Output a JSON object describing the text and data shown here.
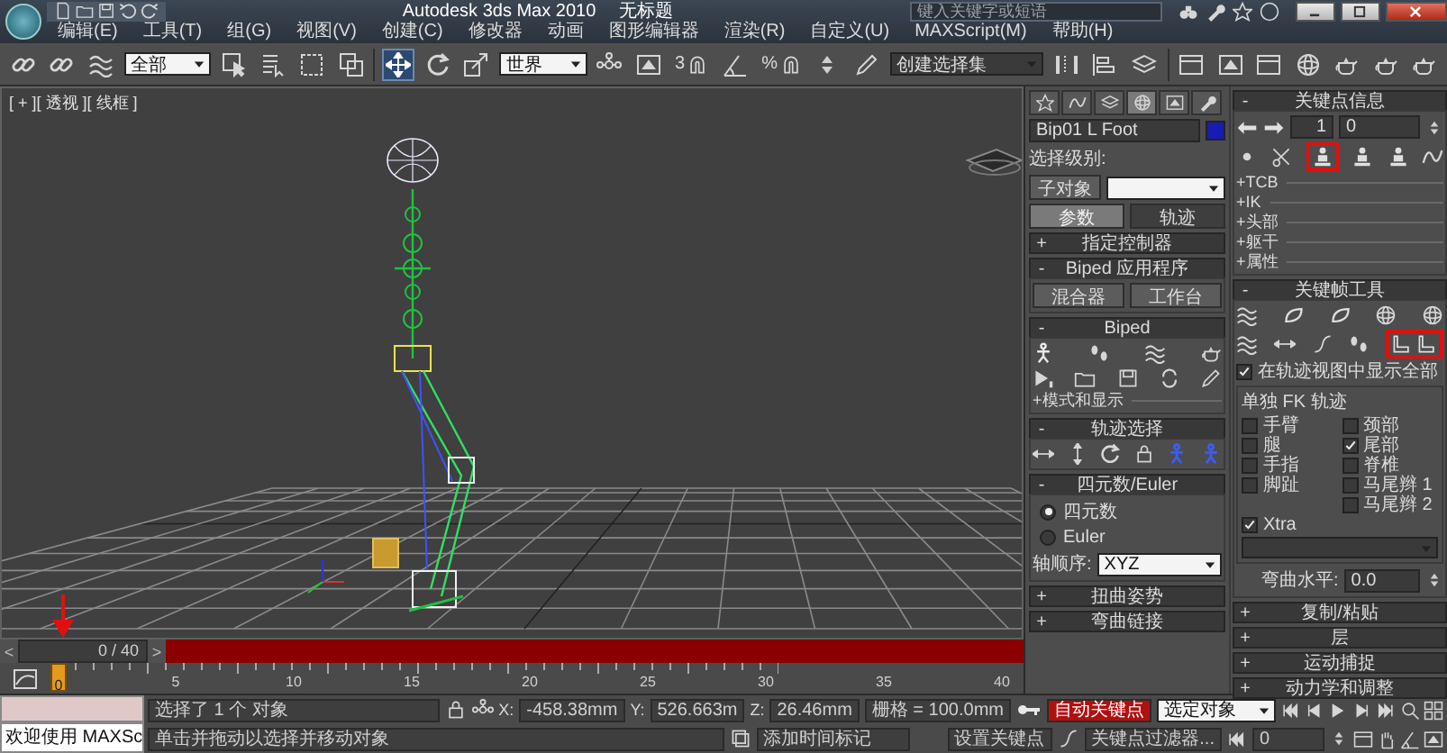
{
  "title_bar": {
    "title": "Autodesk 3ds Max 2010",
    "document": "无标题",
    "search": {
      "placeholder": "键入关键字或短语"
    }
  },
  "menu": [
    "编辑(E)",
    "工具(T)",
    "组(G)",
    "视图(V)",
    "创建(C)",
    "修改器",
    "动画",
    "图形编辑器",
    "渲染(R)",
    "自定义(U)",
    "MAXScript(M)",
    "帮助(H)"
  ],
  "toolbar": {
    "selection_filter": "全部",
    "reference_coords": "世界",
    "snap_toggle": "3",
    "percent_snap": "%",
    "named_selection": "创建选择集"
  },
  "viewport": {
    "label": "[ + ][ 透视 ][ 线框 ]"
  },
  "time_slider": {
    "prev": "<",
    "position": "0 / 40",
    "next": ">"
  },
  "track_bar": {
    "current_frame": "0",
    "ticks": [
      "5",
      "10",
      "15",
      "20",
      "25",
      "30",
      "35",
      "40"
    ]
  },
  "command_panel": {
    "panel_tabs": [
      {
        "selected": false
      },
      {
        "selected": false
      },
      {
        "selected": false
      },
      {
        "selected": true
      },
      {
        "selected": false
      },
      {
        "selected": false
      }
    ],
    "object_name": "Bip01 L Foot",
    "selection_level_label": "选择级别:",
    "subobject_button": "子对象",
    "mode_tabs": [
      {
        "label": "参数",
        "selected": true
      },
      {
        "label": "轨迹",
        "selected": false
      }
    ],
    "left_rollouts": [
      {
        "sign": "+",
        "title": "指定控制器",
        "kind": "collapsed"
      },
      {
        "sign": "-",
        "title": "Biped 应用程序",
        "kind": "buttons",
        "buttons": [
          "混合器",
          "工作台"
        ]
      },
      {
        "sign": "-",
        "title": "Biped",
        "kind": "biped",
        "subsection": "+模式和显示"
      },
      {
        "sign": "-",
        "title": "轨迹选择",
        "kind": "track_selection"
      },
      {
        "sign": "-",
        "title": "四元数/Euler",
        "kind": "rotation",
        "options": [
          {
            "label": "四元数",
            "selected": true
          },
          {
            "label": "Euler",
            "selected": false
          }
        ],
        "axis_order_label": "轴顺序:",
        "axis_order": "XYZ"
      },
      {
        "sign": "+",
        "title": "扭曲姿势",
        "kind": "collapsed"
      },
      {
        "sign": "+",
        "title": "弯曲链接",
        "kind": "collapsed"
      }
    ],
    "right_rollouts": [
      {
        "sign": "-",
        "title": "关键点信息",
        "kind": "key_info",
        "key_number": "1",
        "key_time": "0",
        "sections": [
          "+TCB",
          "+IK",
          "+头部",
          "+躯干",
          "+属性"
        ]
      },
      {
        "sign": "-",
        "title": "关键帧工具",
        "kind": "keyframe_tools",
        "show_all": {
          "label": "在轨迹视图中显示全部",
          "checked": true
        },
        "group_title": "单独 FK 轨迹",
        "tracks": [
          {
            "label": "手臂",
            "checked": false
          },
          {
            "label": "颈部",
            "checked": false
          },
          {
            "label": "腿",
            "checked": false
          },
          {
            "label": "尾部",
            "checked": true
          },
          {
            "label": "手指",
            "checked": false
          },
          {
            "label": "脊椎",
            "checked": false
          },
          {
            "label": "脚趾",
            "checked": false
          },
          {
            "label": "马尾辫 1",
            "checked": false
          },
          {
            "label": "马尾辫 2",
            "checked": false
          },
          {
            "label": "Xtra",
            "checked": true
          }
        ],
        "bend_label": "弯曲水平:",
        "bend_value": "0.0"
      },
      {
        "sign": "+",
        "title": "复制/粘贴",
        "kind": "collapsed"
      },
      {
        "sign": "+",
        "title": "层",
        "kind": "collapsed"
      },
      {
        "sign": "+",
        "title": "运动捕捉",
        "kind": "collapsed"
      },
      {
        "sign": "+",
        "title": "动力学和调整",
        "kind": "collapsed"
      }
    ]
  },
  "status": {
    "script_listener": "欢迎使用 MAXSc",
    "selection_info": "选择了 1 个 对象",
    "prompt": "单击并拖动以选择并移动对象",
    "x_label": "X:",
    "x": "-458.38mm",
    "y_label": "Y:",
    "y": "526.663m",
    "z_label": "Z:",
    "z": "26.46mm",
    "grid": "栅格 = 100.0mm",
    "add_time_tag": "添加时间标记",
    "auto_key": {
      "label": "自动关键点",
      "on": true
    },
    "key_mode": "选定对象",
    "set_key": "设置关键点",
    "key_filters": "关键点过滤器...",
    "frame": "0"
  }
}
